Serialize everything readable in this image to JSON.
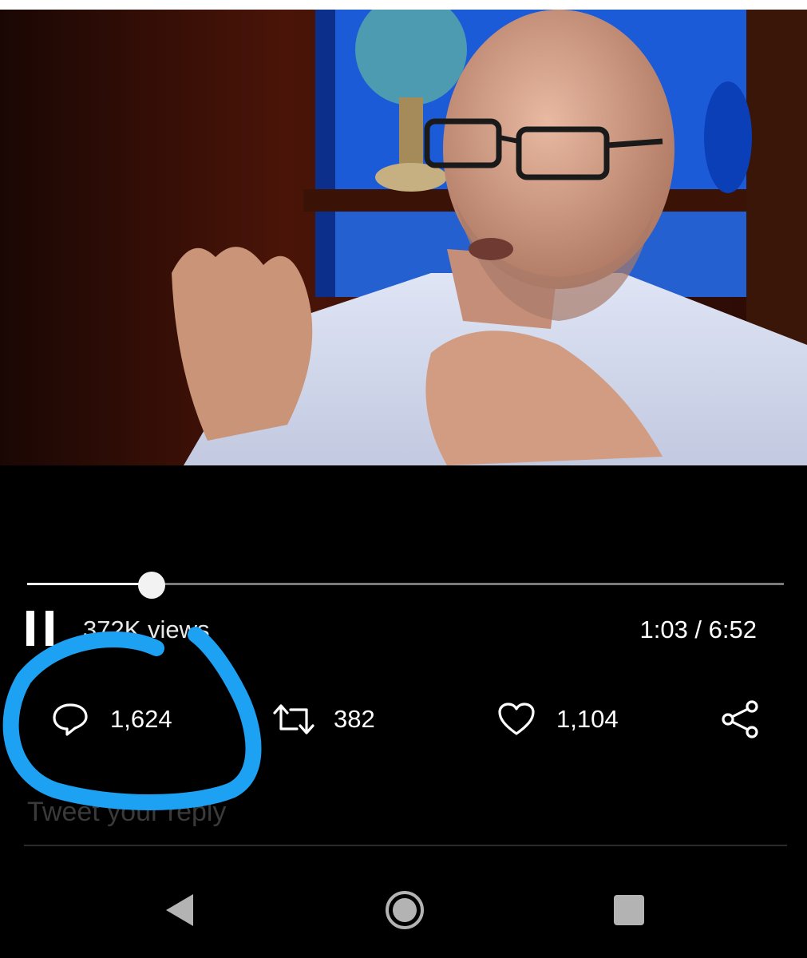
{
  "video": {
    "progress": 0.165,
    "views_text": "372K views",
    "time_text": "1:03 / 6:52"
  },
  "actions": {
    "reply_count": "1,624",
    "retweet_count": "382",
    "like_count": "1,104"
  },
  "icons": {
    "reply": "speech-bubble-icon",
    "retweet": "retweet-icon",
    "like": "heart-icon",
    "share": "share-icon",
    "pause": "pause-icon"
  },
  "reply_placeholder": "Tweet your reply",
  "navbar": {
    "back": "back-triangle-icon",
    "home": "home-circle-icon",
    "recents": "recents-square-icon"
  },
  "annotation": {
    "color": "#1da1f2"
  }
}
